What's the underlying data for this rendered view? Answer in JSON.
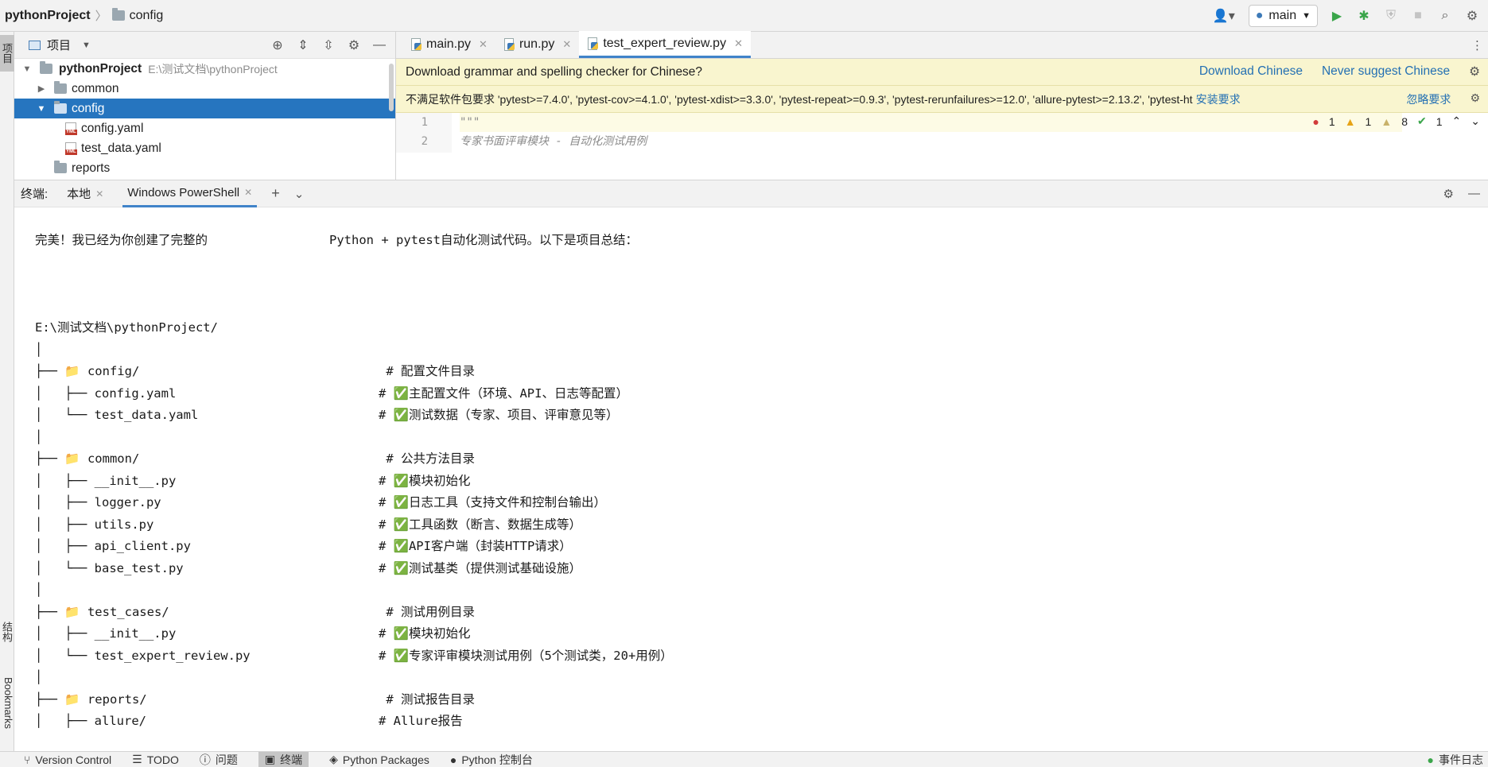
{
  "breadcrumb": {
    "project": "pythonProject",
    "folder": "config"
  },
  "toolbar": {
    "run_config": "main"
  },
  "left_strip": {
    "project_tab": "项目",
    "structure_tab": "结构",
    "bookmarks_tab": "Bookmarks"
  },
  "project_panel": {
    "title": "项目",
    "root": {
      "name": "pythonProject",
      "path": "E:\\测试文档\\pythonProject"
    },
    "items": [
      {
        "label": "common"
      },
      {
        "label": "config"
      },
      {
        "label": "config.yaml"
      },
      {
        "label": "test_data.yaml"
      },
      {
        "label": "reports"
      }
    ]
  },
  "editor": {
    "tabs": [
      {
        "label": "main.py"
      },
      {
        "label": "run.py"
      },
      {
        "label": "test_expert_review.py"
      }
    ],
    "banner1": {
      "text": "Download grammar and spelling checker for Chinese?",
      "link1": "Download Chinese",
      "link2": "Never suggest Chinese"
    },
    "banner2": {
      "text": "不满足软件包要求 'pytest>=7.4.0', 'pytest-cov>=4.1.0', 'pytest-xdist>=3.3.0', 'pytest-repeat>=0.9.3', 'pytest-rerunfailures>=12.0', 'allure-pytest>=2.13.2', 'pytest-ht",
      "link1": "安装要求",
      "link2": "忽略要求"
    },
    "lines": [
      {
        "num": "1",
        "text": "\"\"\""
      },
      {
        "num": "2",
        "text": "专家书面评审模块 - 自动化测试用例"
      }
    ],
    "inspections": {
      "errors": "1",
      "warnings": "1",
      "weak_warnings": "8",
      "ok": "1"
    }
  },
  "terminal": {
    "label": "终端:",
    "tabs": [
      {
        "label": "本地"
      },
      {
        "label": "Windows PowerShell"
      }
    ],
    "intro_left": "完美！我已经为你创建了完整的",
    "intro_right": "Python + pytest自动化测试代码。以下是项目总结：",
    "root_path": "E:\\测试文档\\pythonProject/",
    "rows": [
      {
        "tree": "│",
        "comment": ""
      },
      {
        "tree": "├── 📁 config/",
        "comment": " # 配置文件目录"
      },
      {
        "tree": "│   ├── config.yaml",
        "comment": "# ✅主配置文件（环境、API、日志等配置）"
      },
      {
        "tree": "│   └── test_data.yaml",
        "comment": "# ✅测试数据（专家、项目、评审意见等）"
      },
      {
        "tree": "│",
        "comment": ""
      },
      {
        "tree": "├── 📁 common/",
        "comment": " # 公共方法目录"
      },
      {
        "tree": "│   ├── __init__.py",
        "comment": "# ✅模块初始化"
      },
      {
        "tree": "│   ├── logger.py",
        "comment": "# ✅日志工具（支持文件和控制台输出）"
      },
      {
        "tree": "│   ├── utils.py",
        "comment": "# ✅工具函数（断言、数据生成等）"
      },
      {
        "tree": "│   ├── api_client.py",
        "comment": "# ✅API客户端（封装HTTP请求）"
      },
      {
        "tree": "│   └── base_test.py",
        "comment": "# ✅测试基类（提供测试基础设施）"
      },
      {
        "tree": "│",
        "comment": ""
      },
      {
        "tree": "├── 📁 test_cases/",
        "comment": " # 测试用例目录"
      },
      {
        "tree": "│   ├── __init__.py",
        "comment": "# ✅模块初始化"
      },
      {
        "tree": "│   └── test_expert_review.py",
        "comment": "# ✅专家评审模块测试用例（5个测试类，20+用例）"
      },
      {
        "tree": "│",
        "comment": ""
      },
      {
        "tree": "├── 📁 reports/",
        "comment": " # 测试报告目录"
      },
      {
        "tree": "│   ├── allure/",
        "comment": "# Allure报告"
      }
    ]
  },
  "bottom_bar": {
    "items": [
      {
        "label": "Version Control"
      },
      {
        "label": "TODO"
      },
      {
        "label": "问题"
      },
      {
        "label": "终端"
      },
      {
        "label": "Python Packages"
      },
      {
        "label": "Python 控制台"
      }
    ],
    "event_log": "事件日志"
  },
  "colors": {
    "selection": "#2675bf",
    "banner": "#f9f5cf",
    "link": "#2470b3",
    "run": "#3aa54a"
  }
}
